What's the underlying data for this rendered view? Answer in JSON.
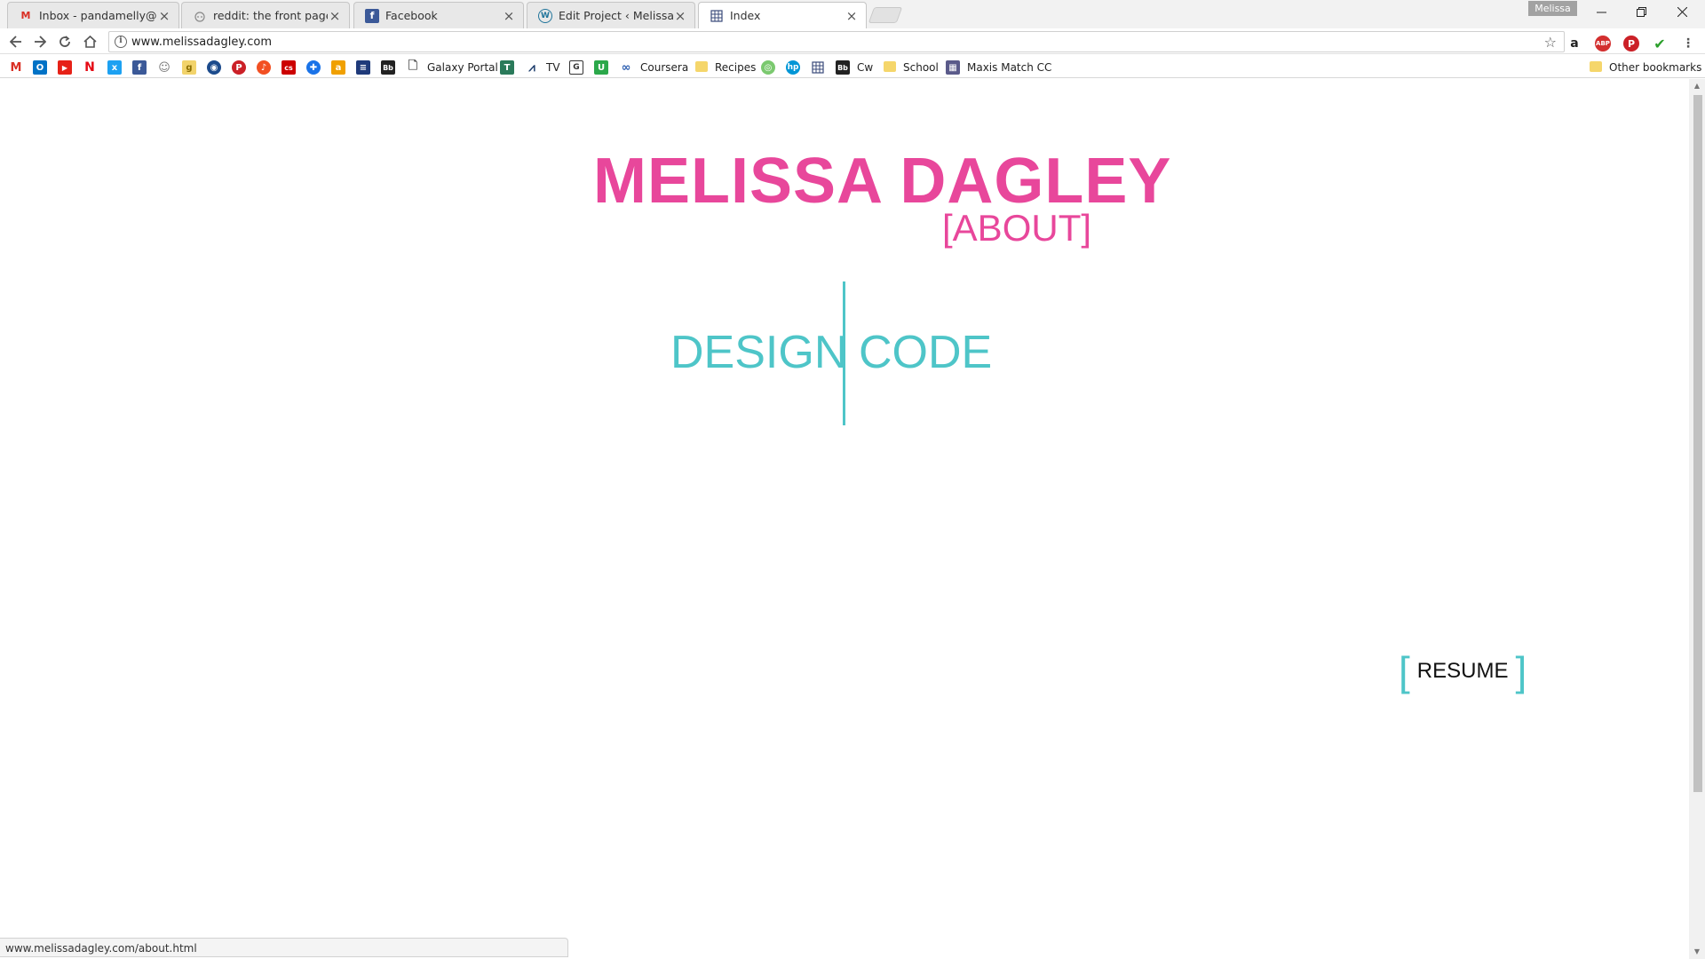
{
  "browser": {
    "tabs": [
      {
        "title": "Inbox - pandamelly@gm",
        "icon": "gmail-icon"
      },
      {
        "title": "reddit: the front page of",
        "icon": "reddit-icon"
      },
      {
        "title": "Facebook",
        "icon": "facebook-icon"
      },
      {
        "title": "Edit Project ‹ Melissa Da",
        "icon": "wordpress-icon"
      },
      {
        "title": "Index",
        "icon": "grid-page-icon"
      }
    ],
    "active_tab_index": 4,
    "profile_name": "Melissa",
    "url": "www.melissadagley.com",
    "status_url": "www.melissadagley.com/about.html"
  },
  "bookmarks": {
    "labels": {
      "galaxy_portal": "Galaxy Portal",
      "tv": "TV",
      "coursera": "Coursera",
      "recipes": "Recipes",
      "cw": "Cw",
      "school": "School",
      "maxis": "Maxis Match CC",
      "other": "Other bookmarks"
    }
  },
  "site": {
    "title": "MELISSA DAGLEY",
    "subtitle": "[ABOUT]",
    "nav_left": "DESIGN",
    "nav_right": "CODE",
    "resume": "RESUME",
    "bracket_open": "[",
    "bracket_close": "]"
  },
  "colors": {
    "brand_pink": "#e8479b",
    "accent_teal": "#4ec5c8"
  }
}
